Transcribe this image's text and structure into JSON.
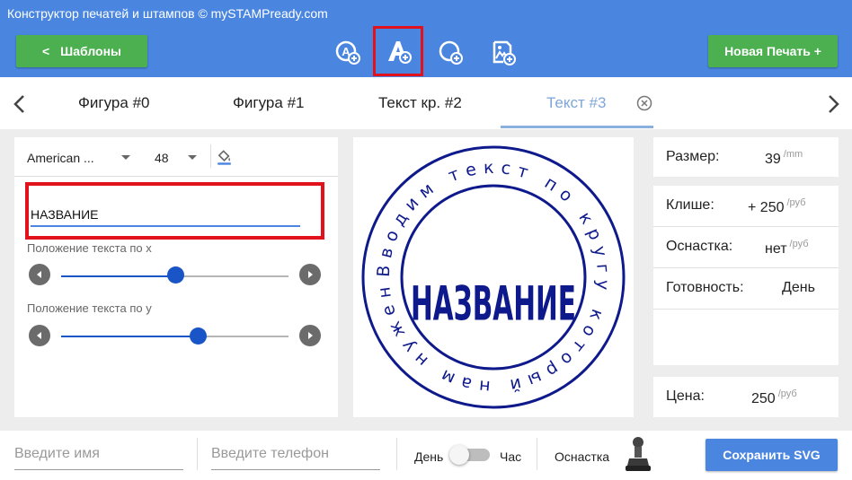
{
  "app": {
    "title": "Конструктор печатей и штампов © mySTAMPready.com"
  },
  "toolbar": {
    "templates_label": "Шаблоны",
    "templates_chevron": "<",
    "new_stamp_label": "Новая Печать +",
    "tools": [
      {
        "icon": "add-shape-icon",
        "active": false
      },
      {
        "icon": "add-text-icon",
        "active": true
      },
      {
        "icon": "add-circle-text-icon",
        "active": false
      },
      {
        "icon": "add-image-icon",
        "active": false
      }
    ]
  },
  "tabs": {
    "items": [
      {
        "label": "Фигура #0",
        "active": false
      },
      {
        "label": "Фигура #1",
        "active": false
      },
      {
        "label": "Текст кр. #2",
        "active": false
      },
      {
        "label": "Текст #3",
        "active": true
      }
    ]
  },
  "editor": {
    "font_name": "American ...",
    "font_size": "48",
    "text_value": "НАЗВАНИЕ",
    "pos_x_label": "Положение текста по x",
    "pos_y_label": "Положение текста по у",
    "pos_x_value": 0.5,
    "pos_y_value": 0.6
  },
  "stamp": {
    "circle_text": "Вводим текст по кругу который нам нужен",
    "center_text": "НАЗВАНИЕ",
    "color": "#0e1a8c"
  },
  "info": {
    "size_label": "Размер:",
    "size_value": "39",
    "size_unit": "/mm",
    "cliche_label": "Клише:",
    "cliche_value": "+ 250",
    "cliche_unit": "/руб",
    "mount_label": "Оснастка:",
    "mount_value": "нет",
    "mount_unit": "/руб",
    "ready_label": "Готовность:",
    "ready_value": "День",
    "price_label": "Цена:",
    "price_value": "250",
    "price_unit": "/руб"
  },
  "bottom": {
    "name_placeholder": "Введите имя",
    "phone_placeholder": "Введите телефон",
    "toggle_left": "День",
    "toggle_right": "Час",
    "mount_label": "Оснастка",
    "save_label": "Сохранить SVG"
  },
  "colors": {
    "primary": "#4a86e0",
    "green": "#4caf50",
    "highlight": "#e2121d",
    "slider": "#1a55c8"
  }
}
